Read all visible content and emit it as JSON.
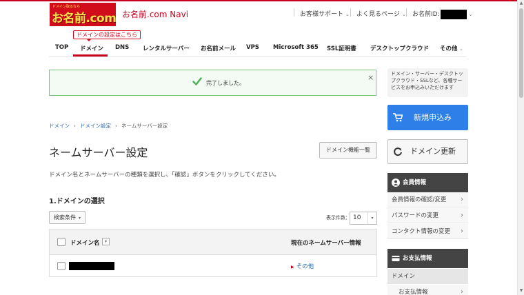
{
  "header": {
    "logo_tag": "ドメイン取るなら",
    "logo_main": "お名前.com",
    "logo_sub": "",
    "navi_title": "お名前.com Navi",
    "support": "お客様サポート",
    "faq": "よく見るページ",
    "member_id_label": "お名前ID:"
  },
  "tooltip": "ドメインの設定はこちら",
  "gnav": {
    "items": [
      "TOP",
      "ドメイン",
      "DNS",
      "レンタルサーバー",
      "お名前メール",
      "VPS",
      "Microsoft 365",
      "SSL証明書",
      "デスクトップクラウド",
      "その他"
    ],
    "active": "ドメイン"
  },
  "alert": {
    "message": "完了しました。",
    "close": "×"
  },
  "breadcrumb": [
    "ドメイン",
    "ドメイン設定",
    "ネームサーバー設定"
  ],
  "page": {
    "title": "ネームサーバー設定",
    "domain_list_button": "ドメイン機能一覧",
    "description": "ドメイン名とネームサーバーの種類を選択し、「確認」ボタンをクリックしてください。",
    "section_title": "1.ドメインの選択",
    "search_condition": "検索条件",
    "display_count_label": "表示件数：",
    "display_count": "10"
  },
  "table": {
    "col_domain": "ドメイン名",
    "col_ns": "現在のネームサーバー情報",
    "rows": [
      {
        "ns": "その他"
      }
    ]
  },
  "sidebar": {
    "promo": "ドメイン・サーバー・デスクトップクラウド・SSLなど、各種サービスをお申込みいただけます",
    "new_button": "新規申込み",
    "renew_button": "ドメイン更新",
    "member_title": "会員情報",
    "member_items": [
      "会員情報の確認/変更",
      "パスワードの変更",
      "コンタクト情報の変更"
    ],
    "payment_title": "お支払情報",
    "payment_items": [
      "ドメイン",
      "お支払情報"
    ]
  },
  "colors": {
    "brand_red": "#c8001f",
    "primary_blue": "#2f7fe9",
    "success_green": "#4caf50"
  }
}
